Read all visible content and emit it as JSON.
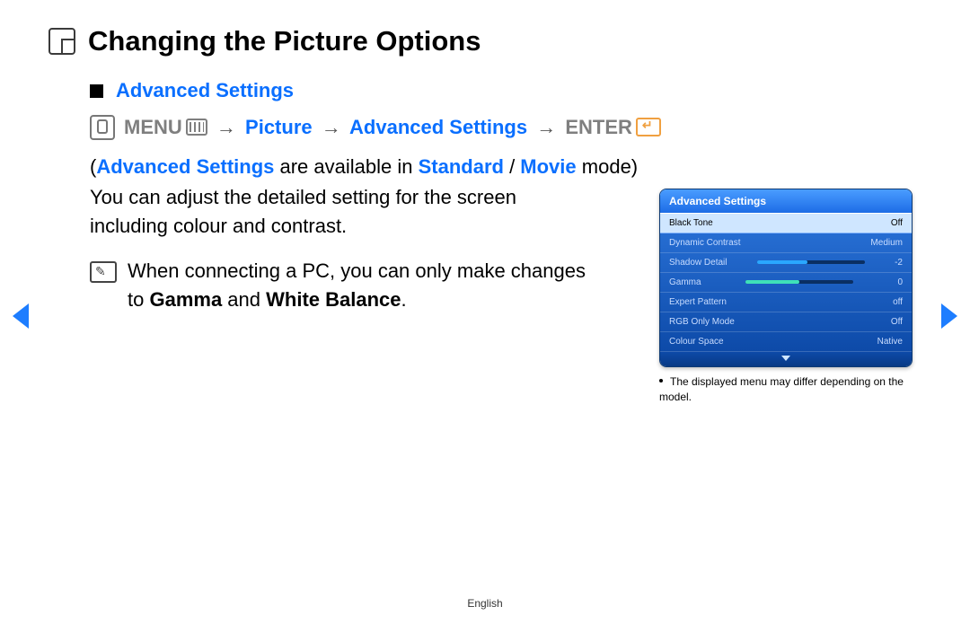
{
  "page_title": "Changing the Picture Options",
  "section_title": "Advanced Settings",
  "nav_path": {
    "menu_label": "MENU",
    "step1": "Picture",
    "step2": "Advanced Settings",
    "enter_label": "ENTER"
  },
  "availability_text": {
    "open_paren": "(",
    "as": "Advanced Settings",
    "mid": " are available in ",
    "mode1": "Standard",
    "slash": " / ",
    "mode2": "Movie",
    "end": " mode)"
  },
  "body_paragraph": "You can adjust the detailed setting for the screen including colour and contrast.",
  "note_text": {
    "pre": "When connecting a PC, you can only make changes to ",
    "gamma": "Gamma",
    "and": " and ",
    "wb": "White Balance",
    "period": "."
  },
  "osd": {
    "title": "Advanced Settings",
    "rows": [
      {
        "label": "Black Tone",
        "value": "Off",
        "selected": true,
        "bar": null
      },
      {
        "label": "Dynamic Contrast",
        "value": "Medium",
        "selected": false,
        "bar": null
      },
      {
        "label": "Shadow Detail",
        "value": "-2",
        "selected": false,
        "bar": {
          "fill": 47,
          "color": "#2aa7ff"
        }
      },
      {
        "label": "Gamma",
        "value": "0",
        "selected": false,
        "bar": {
          "fill": 50,
          "color": "#3fe0b8"
        }
      },
      {
        "label": "Expert Pattern",
        "value": "off",
        "selected": false,
        "bar": null
      },
      {
        "label": "RGB Only Mode",
        "value": "Off",
        "selected": false,
        "bar": null
      },
      {
        "label": "Colour Space",
        "value": "Native",
        "selected": false,
        "bar": null
      }
    ]
  },
  "caption": "The displayed menu may differ depending on the model.",
  "footer_language": "English"
}
